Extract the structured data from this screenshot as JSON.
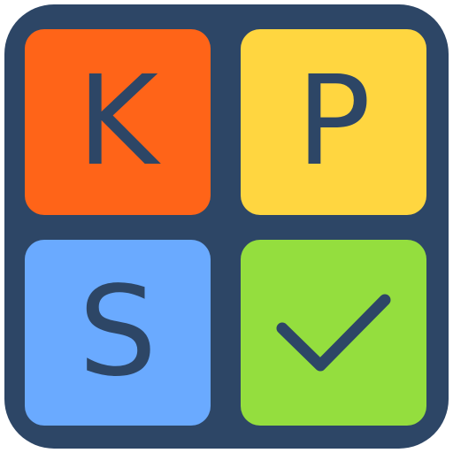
{
  "app_icon": {
    "letters": {
      "k": "K",
      "p": "P",
      "s": "S"
    },
    "icons": {
      "check": "check-icon"
    },
    "colors": {
      "background": "#2d4666",
      "tile_k": "#ff6418",
      "tile_p": "#ffd640",
      "tile_s": "#6aaaff",
      "tile_check": "#94de3e",
      "glyph": "#2d4666"
    }
  }
}
